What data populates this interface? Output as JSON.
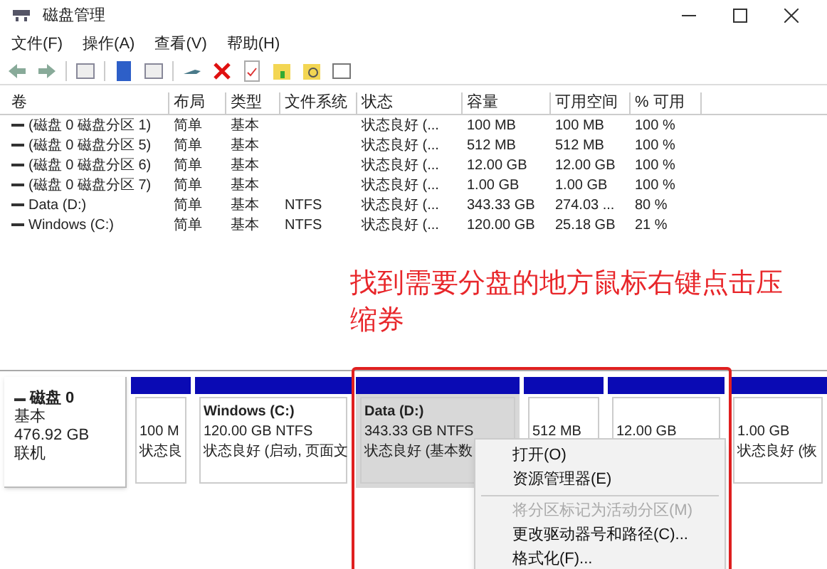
{
  "window": {
    "title": "磁盘管理"
  },
  "menu": [
    "文件(F)",
    "操作(A)",
    "查看(V)",
    "帮助(H)"
  ],
  "table": {
    "columns": [
      "卷",
      "布局",
      "类型",
      "文件系统",
      "状态",
      "容量",
      "可用空间",
      "% 可用"
    ],
    "rows": [
      [
        "(磁盘 0 磁盘分区 1)",
        "简单",
        "基本",
        "",
        "状态良好 (...",
        "100 MB",
        "100 MB",
        "100 %"
      ],
      [
        "(磁盘 0 磁盘分区 5)",
        "简单",
        "基本",
        "",
        "状态良好 (...",
        "512 MB",
        "512 MB",
        "100 %"
      ],
      [
        "(磁盘 0 磁盘分区 6)",
        "简单",
        "基本",
        "",
        "状态良好 (...",
        "12.00 GB",
        "12.00 GB",
        "100 %"
      ],
      [
        "(磁盘 0 磁盘分区 7)",
        "简单",
        "基本",
        "",
        "状态良好 (...",
        "1.00 GB",
        "1.00 GB",
        "100 %"
      ],
      [
        "Data (D:)",
        "简单",
        "基本",
        "NTFS",
        "状态良好 (...",
        "343.33 GB",
        "274.03 ...",
        "80 %"
      ],
      [
        "Windows (C:)",
        "简单",
        "基本",
        "NTFS",
        "状态良好 (...",
        "120.00 GB",
        "25.18 GB",
        "21 %"
      ]
    ]
  },
  "annotation": "找到需要分盘的地方鼠标右键点击压缩券",
  "disk": {
    "name": "磁盘 0",
    "type": "基本",
    "size": "476.92 GB",
    "status": "联机",
    "partitions": [
      {
        "lines": [
          "100 M",
          "状态良"
        ],
        "selected": false
      },
      {
        "title": "Windows  (C:)",
        "lines": [
          "120.00 GB NTFS",
          "状态良好 (启动, 页面文"
        ],
        "selected": false
      },
      {
        "title": "Data  (D:)",
        "lines": [
          "343.33 GB NTFS",
          "状态良好 (基本数"
        ],
        "selected": true
      },
      {
        "lines": [
          "512 MB"
        ],
        "selected": false
      },
      {
        "lines": [
          "12.00 GB"
        ],
        "selected": false
      },
      {
        "lines": [
          "1.00 GB",
          "状态良好 (恢"
        ],
        "selected": false
      }
    ]
  },
  "context_menu": [
    {
      "label": "打开(O)",
      "disabled": false,
      "separator_before": false
    },
    {
      "label": "资源管理器(E)",
      "disabled": false,
      "separator_before": false
    },
    {
      "label": "将分区标记为活动分区(M)",
      "disabled": true,
      "separator_before": true
    },
    {
      "label": "更改驱动器号和路径(C)...",
      "disabled": false,
      "separator_before": false
    },
    {
      "label": "格式化(F)...",
      "disabled": false,
      "separator_before": false
    }
  ]
}
